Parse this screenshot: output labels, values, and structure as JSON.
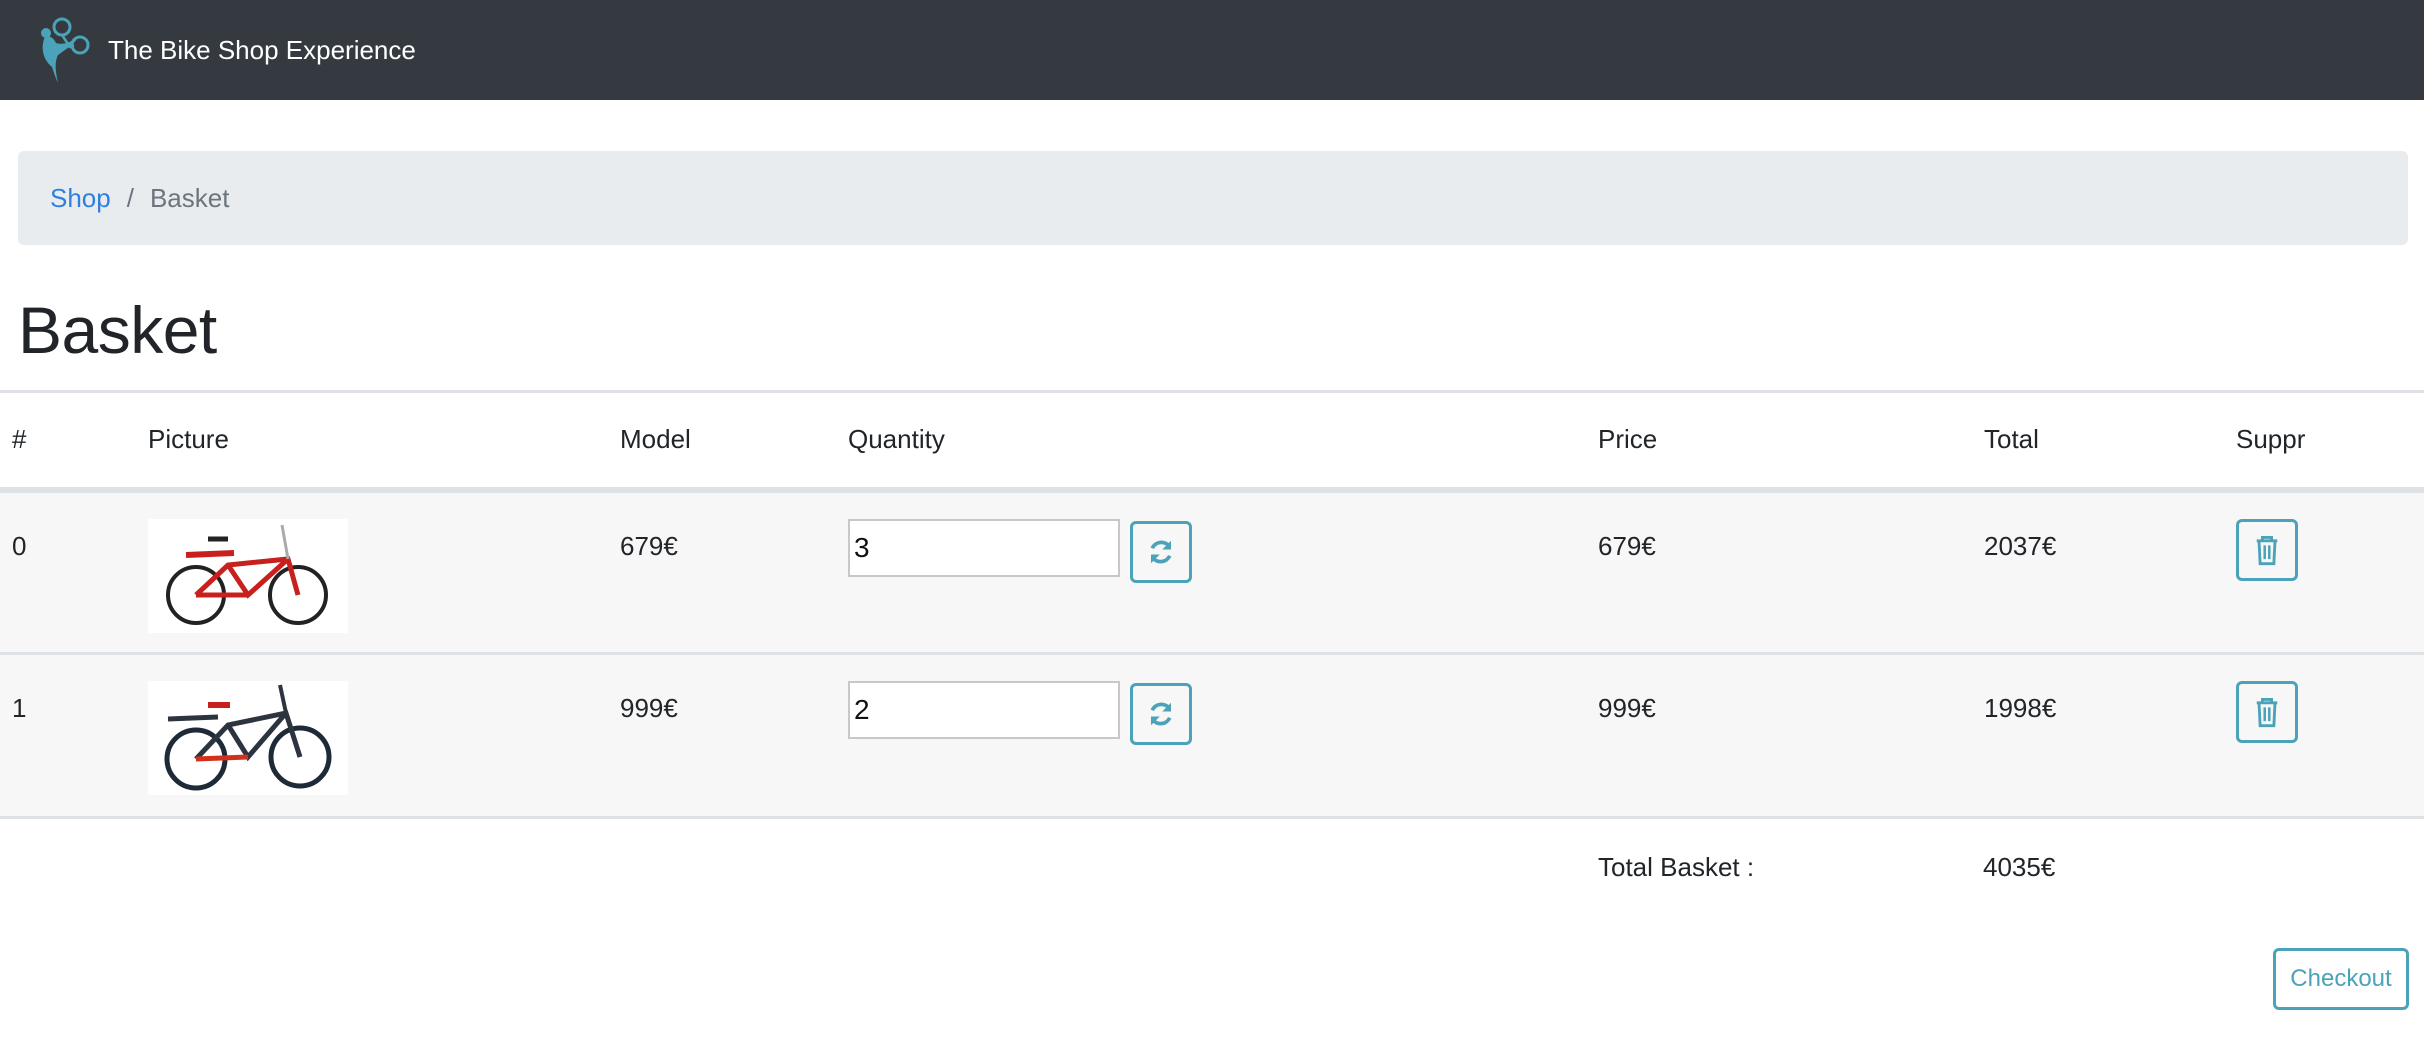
{
  "navbar": {
    "brand": "The Bike Shop Experience",
    "logo_icon": "cyclist-logo-icon"
  },
  "breadcrumb": {
    "items": [
      {
        "label": "Shop",
        "link": true
      },
      {
        "label": "Basket",
        "link": false
      }
    ],
    "separator": "/"
  },
  "page": {
    "title": "Basket"
  },
  "table": {
    "headers": [
      "#",
      "Picture",
      "Model",
      "Quantity",
      "Price",
      "Total",
      "Suppr"
    ],
    "rows": [
      {
        "index": "0",
        "picture": "red-bike-image",
        "model": "679€",
        "quantity": "3",
        "price": "679€",
        "total": "2037€"
      },
      {
        "index": "1",
        "picture": "black-red-bike-image",
        "model": "999€",
        "quantity": "2",
        "price": "999€",
        "total": "1998€"
      }
    ]
  },
  "summary": {
    "label": "Total Basket :",
    "value": "4035€"
  },
  "actions": {
    "checkout_label": "Checkout",
    "refresh_icon": "refresh-icon",
    "delete_icon": "trash-icon"
  },
  "colors": {
    "navbar_bg": "#343a40",
    "accent": "#4aa3b8",
    "link": "#2f7fe0",
    "breadcrumb_bg": "#e9ecef"
  }
}
